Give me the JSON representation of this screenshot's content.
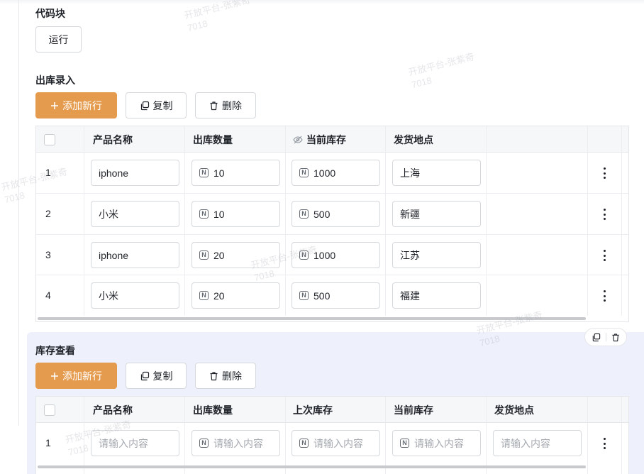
{
  "code_block": {
    "label": "代码块",
    "run_label": "运行"
  },
  "outbound": {
    "label": "出库录入",
    "add_label": "添加新行",
    "copy_label": "复制",
    "delete_label": "删除",
    "columns": [
      "产品名称",
      "出库数量",
      "当前库存",
      "发货地点"
    ],
    "rows": [
      {
        "index": "1",
        "product": "iphone",
        "qty": "10",
        "stock": "1000",
        "location": "上海"
      },
      {
        "index": "2",
        "product": "小米",
        "qty": "10",
        "stock": "500",
        "location": "新疆"
      },
      {
        "index": "3",
        "product": "iphone",
        "qty": "20",
        "stock": "1000",
        "location": "江苏"
      },
      {
        "index": "4",
        "product": "小米",
        "qty": "20",
        "stock": "500",
        "location": "福建"
      }
    ]
  },
  "inventory": {
    "label": "库存查看",
    "add_label": "添加新行",
    "copy_label": "复制",
    "delete_label": "删除",
    "columns": [
      "产品名称",
      "出库数量",
      "上次库存",
      "当前库存",
      "发货地点"
    ],
    "rows": [
      {
        "index": "1",
        "placeholder": "请输入内容"
      }
    ]
  },
  "watermark": {
    "line1": "开放平台-张紫奇",
    "line2": "7018"
  },
  "colors": {
    "primary": "#e59b4e",
    "section_bg": "#eef1fb"
  }
}
